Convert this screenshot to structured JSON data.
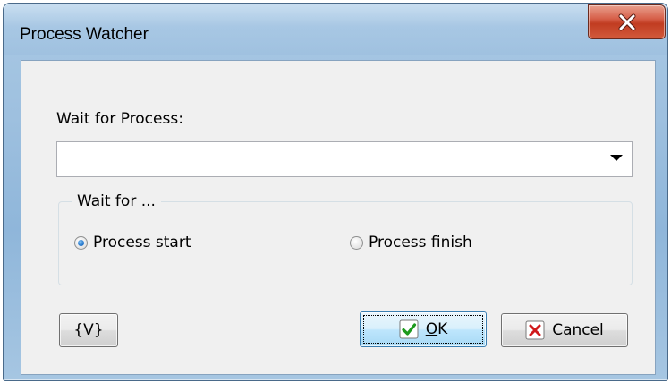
{
  "window": {
    "title": "Process Watcher"
  },
  "form": {
    "wait_for_process_label": "Wait for Process:",
    "process_combo_value": "",
    "group_label": "Wait for ...",
    "options": [
      {
        "label": "Process start",
        "checked": true
      },
      {
        "label": "Process finish",
        "checked": false
      }
    ]
  },
  "buttons": {
    "variables_label": "{V}",
    "ok_mnemonic": "O",
    "ok_rest": "K",
    "cancel_mnemonic": "C",
    "cancel_rest": "ancel"
  },
  "icons": {
    "close": "close-icon",
    "ok": "checkmark-icon",
    "cancel": "x-cross-icon",
    "dropdown": "chevron-down-icon"
  },
  "colors": {
    "titlebar": "#9ec0df",
    "close_button": "#c13c21",
    "ok_check": "#1e9a1e",
    "cancel_x": "#d0191b"
  }
}
